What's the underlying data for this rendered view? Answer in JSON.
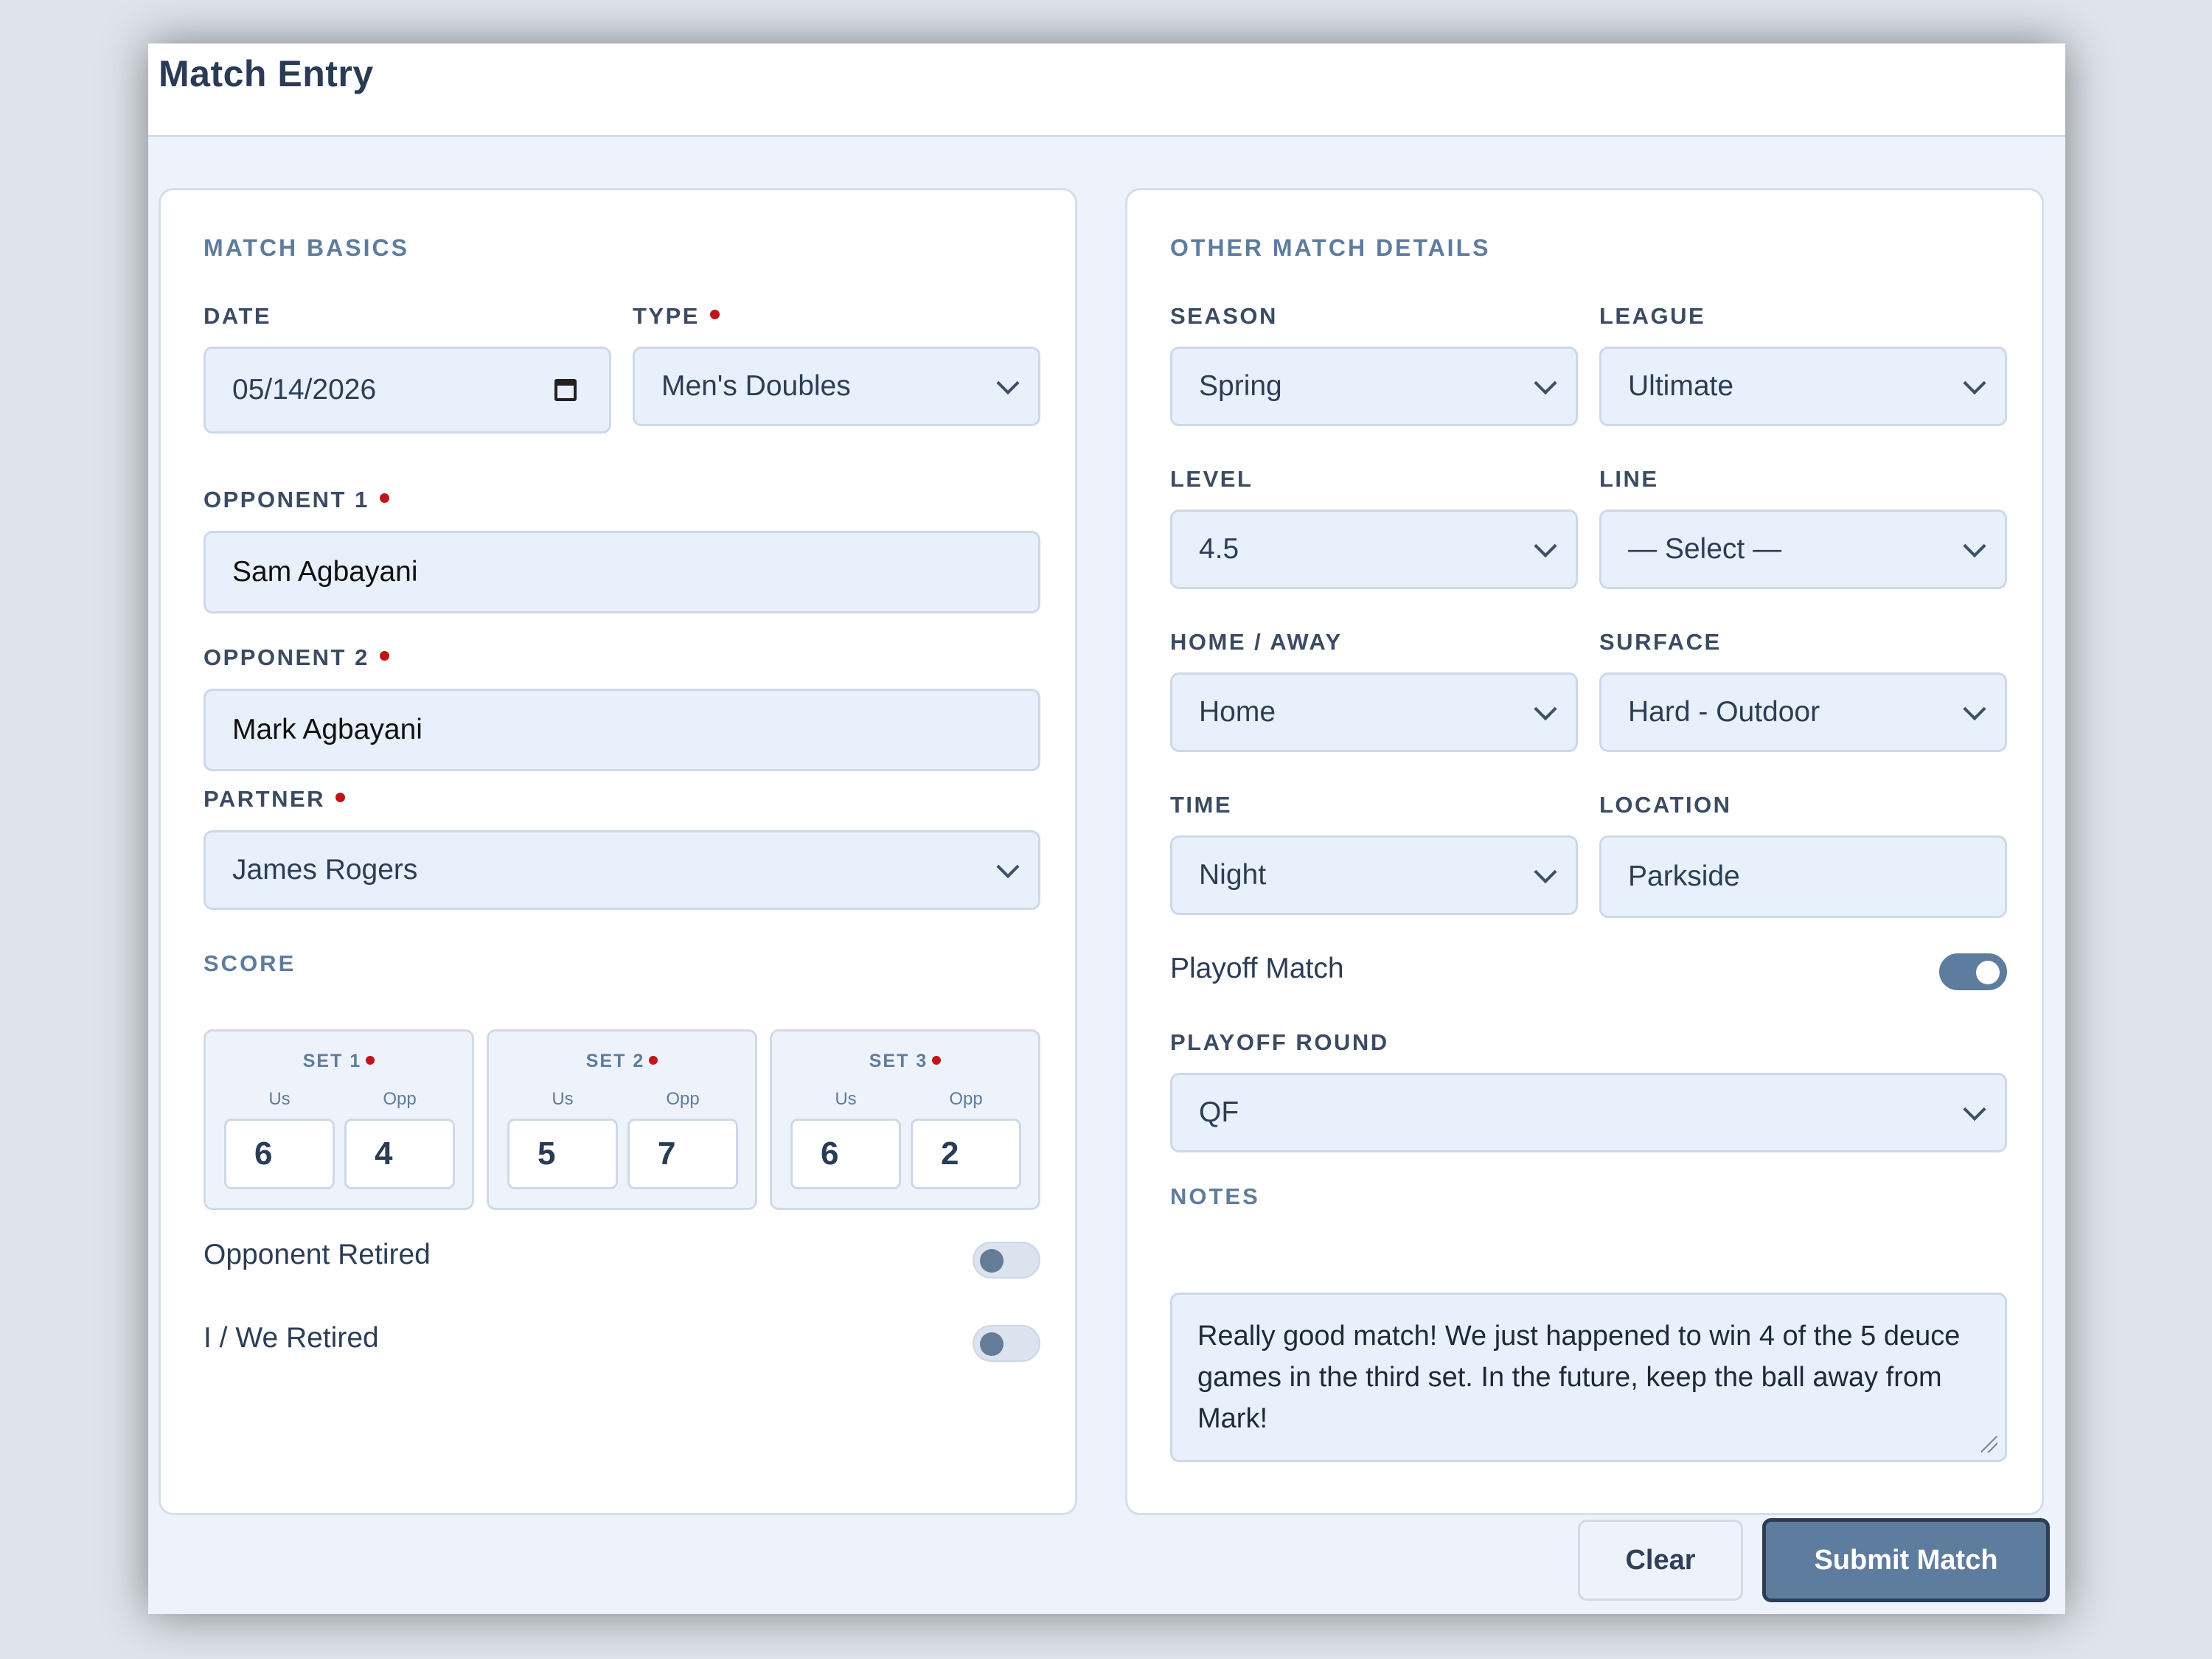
{
  "window": {
    "title": "Match Entry"
  },
  "basics": {
    "section_title": "MATCH BASICS",
    "date": {
      "label": "DATE",
      "value": "05/14/2026"
    },
    "type": {
      "label": "TYPE",
      "value": "Men's Doubles"
    },
    "opponent1": {
      "label": "OPPONENT 1",
      "value": "Sam Agbayani"
    },
    "opponent2": {
      "label": "OPPONENT 2",
      "value": "Mark Agbayani"
    },
    "partner": {
      "label": "PARTNER",
      "value": "James Rogers"
    },
    "score": {
      "label": "SCORE",
      "us_label": "Us",
      "opp_label": "Opp",
      "sets": [
        {
          "label": "SET 1",
          "us": "6",
          "opp": "4"
        },
        {
          "label": "SET 2",
          "us": "5",
          "opp": "7"
        },
        {
          "label": "SET 3",
          "us": "6",
          "opp": "2"
        }
      ]
    },
    "opponent_retired": {
      "label": "Opponent Retired",
      "on": false
    },
    "we_retired": {
      "label": "I / We Retired",
      "on": false
    }
  },
  "details": {
    "section_title": "OTHER MATCH DETAILS",
    "season": {
      "label": "SEASON",
      "value": "Spring"
    },
    "league": {
      "label": "LEAGUE",
      "value": "Ultimate"
    },
    "level": {
      "label": "LEVEL",
      "value": "4.5"
    },
    "line": {
      "label": "LINE",
      "value": "— Select —"
    },
    "home_away": {
      "label": "HOME / AWAY",
      "value": "Home"
    },
    "surface": {
      "label": "SURFACE",
      "value": "Hard - Outdoor"
    },
    "time": {
      "label": "TIME",
      "value": "Night"
    },
    "location": {
      "label": "LOCATION",
      "value": "Parkside"
    },
    "playoff_match": {
      "label": "Playoff Match",
      "on": true
    },
    "playoff_round": {
      "label": "PLAYOFF ROUND",
      "value": "QF"
    },
    "notes": {
      "label": "NOTES",
      "value": "Really good match! We just happened to win 4 of the 5 deuce games in the third set. In the future, keep the ball away from Mark!"
    }
  },
  "actions": {
    "clear": "Clear",
    "submit": "Submit Match"
  },
  "colors": {
    "accent": "#5e7c9e",
    "required_dot": "#c0141b",
    "title": "#2a3b55",
    "field_bg": "#e8f0fb"
  }
}
